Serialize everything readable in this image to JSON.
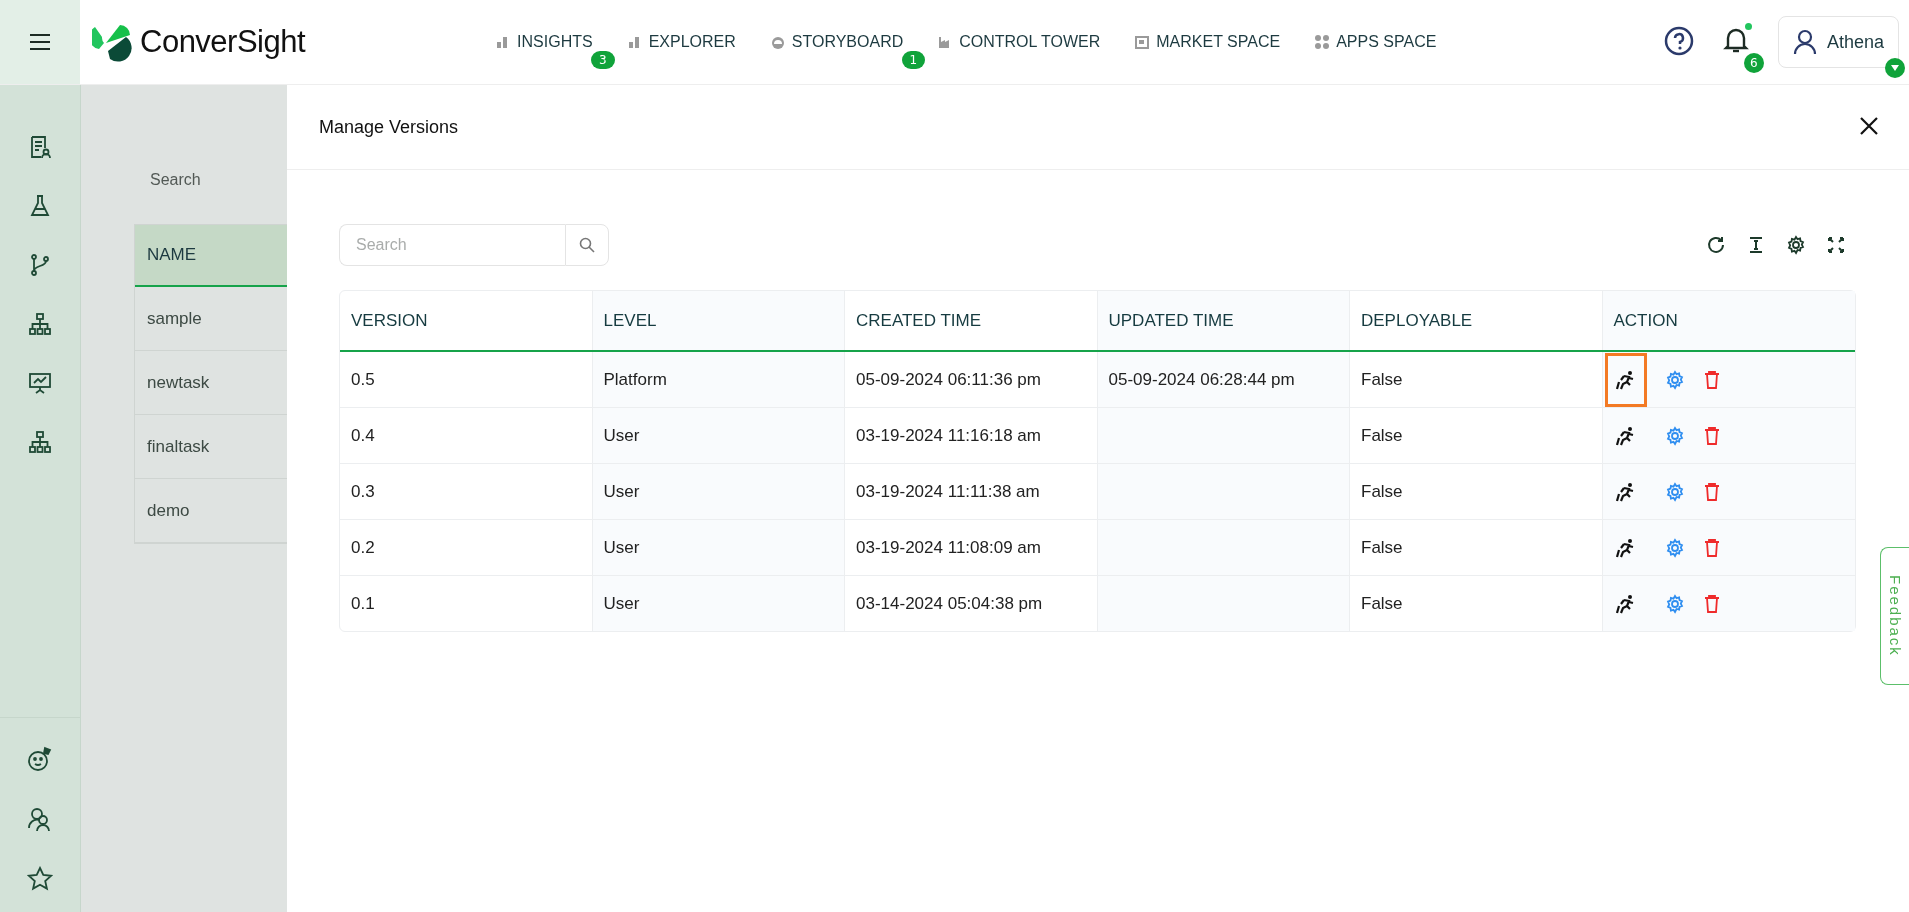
{
  "top_bar": {
    "brand": "ConverSight",
    "nav": [
      {
        "label": "INSIGHTS",
        "kind": "bars",
        "badge": "3"
      },
      {
        "label": "EXPLORER",
        "kind": "bars"
      },
      {
        "label": "STORYBOARD",
        "kind": "gauge",
        "badge": "1"
      },
      {
        "label": "CONTROL TOWER",
        "kind": "factory"
      },
      {
        "label": "MARKET SPACE",
        "kind": "store"
      },
      {
        "label": "APPS SPACE",
        "kind": "dots"
      }
    ],
    "notifications": {
      "count": "6",
      "unread": true
    },
    "user": {
      "name": "Athena"
    }
  },
  "background_page": {
    "search": {
      "placeholder": "Search"
    },
    "table": {
      "columns": [
        "NAME"
      ],
      "rows": [
        "sample",
        "newtask",
        "finaltask",
        "demo"
      ]
    }
  },
  "dialog": {
    "title": "Manage Versions",
    "search": {
      "placeholder": "Search"
    },
    "table": {
      "columns": [
        "VERSION",
        "LEVEL",
        "CREATED TIME",
        "UPDATED TIME",
        "DEPLOYABLE",
        "ACTION"
      ],
      "rows": [
        {
          "version": "0.5",
          "level": "Platform",
          "created_time": "05-09-2024 06:11:36 pm",
          "updated_time": "05-09-2024 06:28:44 pm",
          "deployable": "False",
          "highlighted": true
        },
        {
          "version": "0.4",
          "level": "User",
          "created_time": "03-19-2024 11:16:18 am",
          "deployable": "False",
          "highlighted": false
        },
        {
          "version": "0.3",
          "level": "User",
          "created_time": "03-19-2024 11:11:38 am",
          "deployable": "False",
          "highlighted": false
        },
        {
          "version": "0.2",
          "level": "User",
          "created_time": "03-19-2024 11:08:09 am",
          "deployable": "False",
          "highlighted": false
        },
        {
          "version": "0.1",
          "level": "User",
          "created_time": "03-14-2024 05:04:38 pm",
          "deployable": "False",
          "highlighted": false
        }
      ]
    }
  },
  "feedback_tab": {
    "label": "Feedback"
  }
}
